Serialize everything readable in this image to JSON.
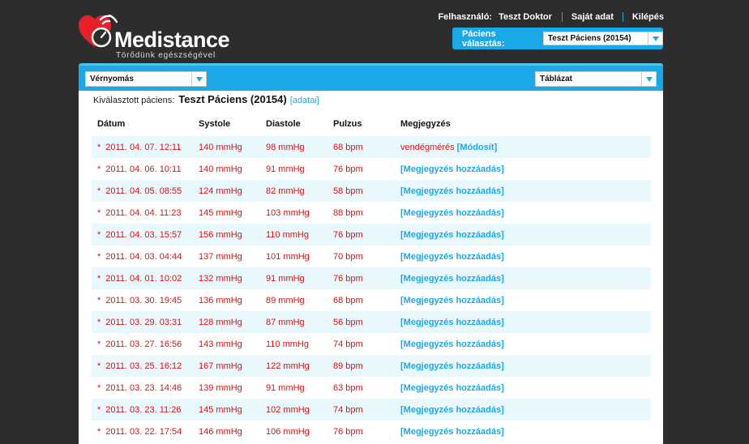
{
  "brand": {
    "name": "Medistance",
    "tagline": "Törődünk egészségével",
    "accent": "#1aa9e8",
    "heart_color": "#e8202a"
  },
  "topnav": {
    "user_label": "Felhasználó:",
    "user_name": "Teszt Doktor",
    "own_data": "Saját adat",
    "logout": "Kilépés"
  },
  "patient_picker": {
    "label": "Páciens választás:",
    "selected": "Teszt Páciens (20154)"
  },
  "toolbar": {
    "measurement_type": "Vérnyomás",
    "view_mode": "Táblázat"
  },
  "selected_patient": {
    "label": "Kiválasztott páciens:",
    "name": "Teszt Páciens (20154)",
    "details_link": "[adatai]"
  },
  "table": {
    "headers": {
      "date": "Dátum",
      "systole": "Systole",
      "diastole": "Diastole",
      "pulse": "Pulzus",
      "note": "Megjegyzés"
    },
    "rows": [
      {
        "star": "*",
        "date": "2011. 04. 07. 12:11",
        "systole": "140 mmHg",
        "diastole": "98 mmHg",
        "pulse": "68 bpm",
        "note": "vendégmérés",
        "action": "[Módosít]"
      },
      {
        "star": "*",
        "date": "2011. 04. 06. 10:11",
        "systole": "140 mmHg",
        "diastole": "91 mmHg",
        "pulse": "76 bpm",
        "note": "",
        "action": "[Megjegyzés hozzáadás]"
      },
      {
        "star": "*",
        "date": "2011. 04. 05. 08:55",
        "systole": "124 mmHg",
        "diastole": "82 mmHg",
        "pulse": "58 bpm",
        "note": "",
        "action": "[Megjegyzés hozzáadás]"
      },
      {
        "star": "*",
        "date": "2011. 04. 04. 11:23",
        "systole": "145 mmHg",
        "diastole": "103 mmHg",
        "pulse": "88 bpm",
        "note": "",
        "action": "[Megjegyzés hozzáadás]"
      },
      {
        "star": "*",
        "date": "2011. 04. 03. 15:57",
        "systole": "156 mmHg",
        "diastole": "110 mmHg",
        "pulse": "76 bpm",
        "note": "",
        "action": "[Megjegyzés hozzáadás]"
      },
      {
        "star": "*",
        "date": "2011. 04. 03. 04:44",
        "systole": "137 mmHg",
        "diastole": "101 mmHg",
        "pulse": "70 bpm",
        "note": "",
        "action": "[Megjegyzés hozzáadás]"
      },
      {
        "star": "*",
        "date": "2011. 04. 01. 10:02",
        "systole": "132 mmHg",
        "diastole": "91 mmHg",
        "pulse": "76 bpm",
        "note": "",
        "action": "[Megjegyzés hozzáadás]"
      },
      {
        "star": "*",
        "date": "2011. 03. 30. 19:45",
        "systole": "136 mmHg",
        "diastole": "89 mmHg",
        "pulse": "68 bpm",
        "note": "",
        "action": "[Megjegyzés hozzáadás]"
      },
      {
        "star": "*",
        "date": "2011. 03. 29. 03:31",
        "systole": "128 mmHg",
        "diastole": "87 mmHg",
        "pulse": "56 bpm",
        "note": "",
        "action": "[Megjegyzés hozzáadás]"
      },
      {
        "star": "*",
        "date": "2011. 03. 27. 16:56",
        "systole": "143 mmHg",
        "diastole": "110 mmHg",
        "pulse": "74 bpm",
        "note": "",
        "action": "[Megjegyzés hozzáadás]"
      },
      {
        "star": "*",
        "date": "2011. 03. 25. 16:12",
        "systole": "167 mmHg",
        "diastole": "122 mmHg",
        "pulse": "89 bpm",
        "note": "",
        "action": "[Megjegyzés hozzáadás]"
      },
      {
        "star": "*",
        "date": "2011. 03. 23. 14:46",
        "systole": "139 mmHg",
        "diastole": "91 mmHg",
        "pulse": "63 bpm",
        "note": "",
        "action": "[Megjegyzés hozzáadás]"
      },
      {
        "star": "*",
        "date": "2011. 03. 23. 11:26",
        "systole": "145 mmHg",
        "diastole": "102 mmHg",
        "pulse": "74 bpm",
        "note": "",
        "action": "[Megjegyzés hozzáadás]"
      },
      {
        "star": "*",
        "date": "2011. 03. 22. 17:54",
        "systole": "146 mmHg",
        "diastole": "106 mmHg",
        "pulse": "76 bpm",
        "note": "",
        "action": "[Megjegyzés hozzáadás]"
      }
    ]
  }
}
